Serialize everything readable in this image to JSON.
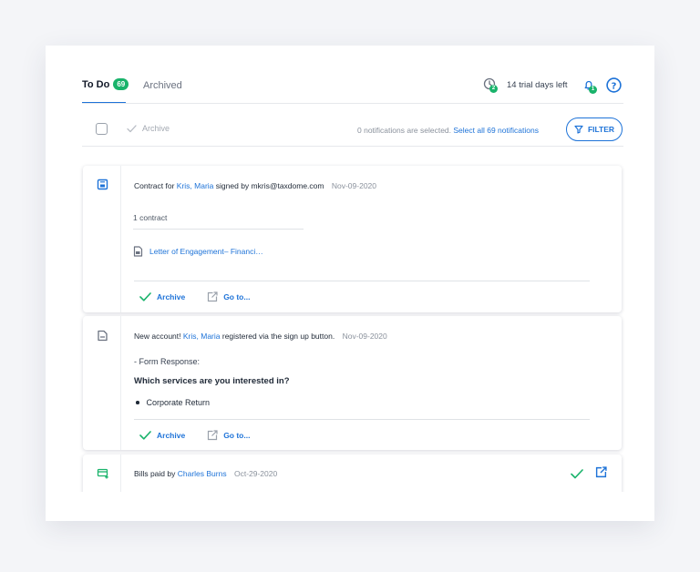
{
  "tabs": {
    "todo_label": "To Do",
    "todo_count": "69",
    "archived_label": "Archived"
  },
  "header": {
    "activity_count": "2",
    "trial_text": "14 trial days left",
    "bell_count": "1"
  },
  "toolbar": {
    "archive_label": "Archive",
    "selected_info": "0 notifications are selected.",
    "select_all": "Select all 69 notifications",
    "filter_label": "FILTER"
  },
  "notifications": [
    {
      "prefix": "Contract for",
      "person": "Kris, Maria",
      "middle": "signed by mkris@taxdome.com",
      "date": "Nov-09-2020",
      "count_text": "1 contract",
      "document": "Letter of Engagement– Financi…",
      "archive_label": "Archive",
      "goto_label": "Go to..."
    },
    {
      "prefix": "New account!",
      "person": "Kris, Maria",
      "middle": "registered via the sign up button.",
      "date": "Nov-09-2020",
      "form_label": "- Form Response:",
      "question": "Which services are you interested in?",
      "answer": "Corporate Return",
      "archive_label": "Archive",
      "goto_label": "Go to..."
    },
    {
      "prefix": "Bills paid by",
      "person": "Charles Burns",
      "date": "Oct-29-2020"
    }
  ],
  "colors": {
    "accent": "#1e73d8",
    "success": "#19b36b"
  }
}
